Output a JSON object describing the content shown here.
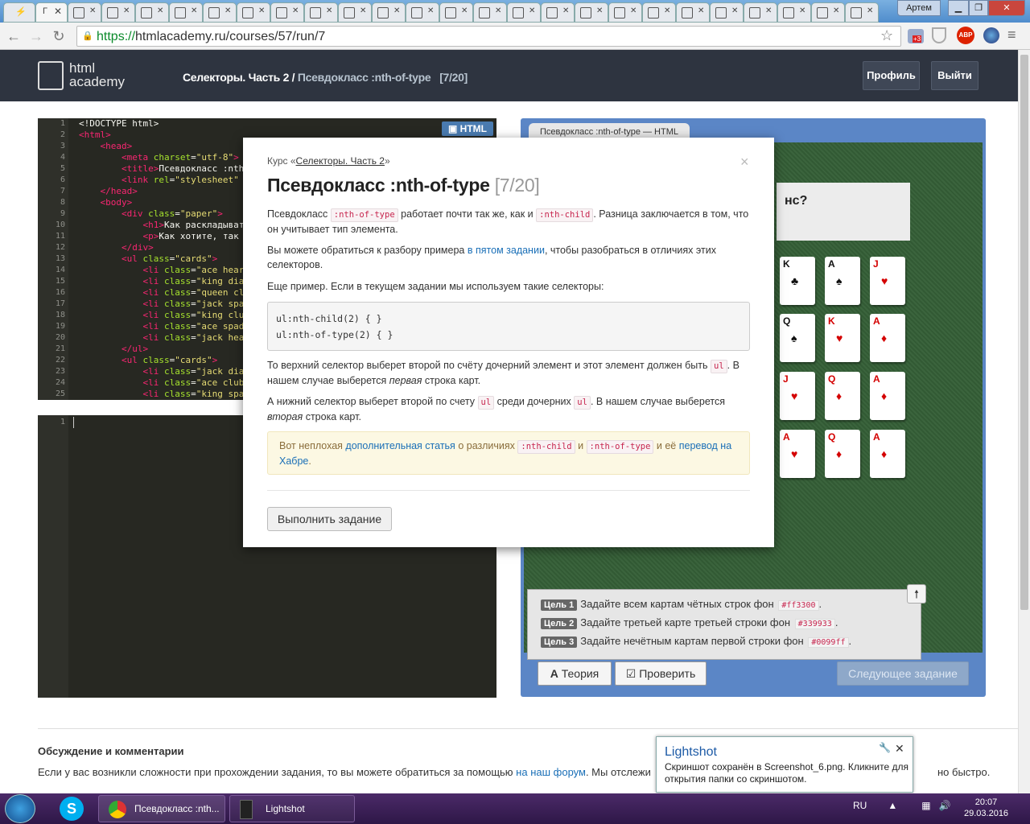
{
  "browser": {
    "url_scheme": "https://",
    "url_rest": "htmlacademy.ru/courses/57/run/7",
    "user_label": "Артем",
    "active_tab_label": "Г",
    "ext_badge": "+3",
    "abp_label": "ABP"
  },
  "site": {
    "logo_line1": "html",
    "logo_line2": "academy",
    "crumb_course": "Селекторы. Часть 2 /",
    "crumb_lesson": "Псевдокласс :nth-of-type",
    "crumb_count": "[7/20]",
    "profile_label": "Профиль",
    "logout_label": "Выйти"
  },
  "editor": {
    "tag_label": "HTML",
    "lines": [
      {
        "n": "1",
        "html": "<span class='w'>&lt;!DOCTYPE html&gt;</span>"
      },
      {
        "n": "2",
        "html": "<span class='t'>&lt;html&gt;</span>"
      },
      {
        "n": "3",
        "html": "    <span class='t'>&lt;head&gt;</span>"
      },
      {
        "n": "4",
        "html": "        <span class='t'>&lt;meta</span> <span class='a'>charset</span>=<span class='s'>\"utf-8\"</span><span class='t'>&gt;</span>"
      },
      {
        "n": "5",
        "html": "        <span class='t'>&lt;title&gt;</span><span class='w'>Псевдокласс :nth</span>"
      },
      {
        "n": "6",
        "html": "        <span class='t'>&lt;link</span> <span class='a'>rel</span>=<span class='s'>\"stylesheet\"</span>"
      },
      {
        "n": "7",
        "html": "    <span class='t'>&lt;/head&gt;</span>"
      },
      {
        "n": "8",
        "html": "    <span class='t'>&lt;body&gt;</span>"
      },
      {
        "n": "9",
        "html": "        <span class='t'>&lt;div</span> <span class='a'>class</span>=<span class='s'>\"paper\"</span><span class='t'>&gt;</span>"
      },
      {
        "n": "10",
        "html": "            <span class='t'>&lt;h1&gt;</span><span class='w'>Как раскладыват</span>"
      },
      {
        "n": "11",
        "html": "            <span class='t'>&lt;p&gt;</span><span class='w'>Как хотите, так</span>"
      },
      {
        "n": "12",
        "html": "        <span class='t'>&lt;/div&gt;</span>"
      },
      {
        "n": "13",
        "html": "        <span class='t'>&lt;ul</span> <span class='a'>class</span>=<span class='s'>\"cards\"</span><span class='t'>&gt;</span>"
      },
      {
        "n": "14",
        "html": "            <span class='t'>&lt;li</span> <span class='a'>class</span>=<span class='s'>\"ace hear</span>"
      },
      {
        "n": "15",
        "html": "            <span class='t'>&lt;li</span> <span class='a'>class</span>=<span class='s'>\"king dia</span>"
      },
      {
        "n": "16",
        "html": "            <span class='t'>&lt;li</span> <span class='a'>class</span>=<span class='s'>\"queen cl</span>"
      },
      {
        "n": "17",
        "html": "            <span class='t'>&lt;li</span> <span class='a'>class</span>=<span class='s'>\"jack spa</span>"
      },
      {
        "n": "18",
        "html": "            <span class='t'>&lt;li</span> <span class='a'>class</span>=<span class='s'>\"king clu</span>"
      },
      {
        "n": "19",
        "html": "            <span class='t'>&lt;li</span> <span class='a'>class</span>=<span class='s'>\"ace spad</span>"
      },
      {
        "n": "20",
        "html": "            <span class='t'>&lt;li</span> <span class='a'>class</span>=<span class='s'>\"jack hea</span>"
      },
      {
        "n": "21",
        "html": "        <span class='t'>&lt;/ul&gt;</span>"
      },
      {
        "n": "22",
        "html": "        <span class='t'>&lt;ul</span> <span class='a'>class</span>=<span class='s'>\"cards\"</span><span class='t'>&gt;</span>"
      },
      {
        "n": "23",
        "html": "            <span class='t'>&lt;li</span> <span class='a'>class</span>=<span class='s'>\"jack dia</span>"
      },
      {
        "n": "24",
        "html": "            <span class='t'>&lt;li</span> <span class='a'>class</span>=<span class='s'>\"ace club</span>"
      },
      {
        "n": "25",
        "html": "            <span class='t'>&lt;li</span> <span class='a'>class</span>=<span class='s'>\"king spa</span>"
      }
    ],
    "css_line_no": "1"
  },
  "preview": {
    "tab_label": "Псевдокласс :nth-of-type — HTML",
    "paper_heading": "нс?",
    "cards": [
      {
        "rank": "K",
        "suit": "♣",
        "color": "blk"
      },
      {
        "rank": "A",
        "suit": "♠",
        "color": "blk"
      },
      {
        "rank": "J",
        "suit": "♥",
        "color": "red"
      },
      {
        "rank": "Q",
        "suit": "♠",
        "color": "blk"
      },
      {
        "rank": "K",
        "suit": "♥",
        "color": "red"
      },
      {
        "rank": "A",
        "suit": "♦",
        "color": "red"
      },
      {
        "rank": "J",
        "suit": "♥",
        "color": "red"
      },
      {
        "rank": "Q",
        "suit": "♦",
        "color": "red"
      },
      {
        "rank": "A",
        "suit": "♦",
        "color": "red"
      },
      {
        "rank": "A",
        "suit": "♥",
        "color": "red"
      },
      {
        "rank": "Q",
        "suit": "♦",
        "color": "red"
      },
      {
        "rank": "A",
        "suit": "♦",
        "color": "red"
      }
    ],
    "goals": [
      {
        "label": "Цель 1",
        "text": "Задайте всем картам чётных строк фон",
        "code": "#ff3300",
        "end": "."
      },
      {
        "label": "Цель 2",
        "text": "Задайте третьей карте третьей строки фон",
        "code": "#339933",
        "end": "."
      },
      {
        "label": "Цель 3",
        "text": "Задайте нечётным картам первой строки фон",
        "code": "#0099ff",
        "end": "."
      }
    ],
    "theory_label": "Теория",
    "check_label": "Проверить",
    "next_label": "Следующее задание"
  },
  "modal": {
    "course_prefix": "Курс «",
    "course_link": "Селекторы. Часть 2",
    "course_suffix": "»",
    "close": "×",
    "title": "Псевдокласс :nth-of-type",
    "title_count": "[7/20]",
    "p1_a": "Псевдокласс",
    "p1_code1": ":nth-of-type",
    "p1_b": "работает почти так же, как и",
    "p1_code2": ":nth-child",
    "p1_c": ". Разница заключается в том, что он учитывает тип элемента.",
    "p2_a": "Вы можете обратиться к разбору примера",
    "p2_link": "в пятом задании",
    "p2_b": ", чтобы разобраться в отличиях этих селекторов.",
    "p3": "Еще пример. Если в текущем задании мы используем такие селекторы:",
    "pre1": "ul:nth-child(2) { }",
    "pre2": "ul:nth-of-type(2) { }",
    "p4_a": "То верхний селектор выберет второй по счёту дочерний элемент и этот элемент должен быть",
    "p4_code": "ul",
    "p4_b": ". В нашем случае выберется",
    "p4_em": "первая",
    "p4_c": "строка карт.",
    "p5_a": "А нижний селектор выберет второй по счету",
    "p5_code1": "ul",
    "p5_b": "среди дочерних",
    "p5_code2": "ul",
    "p5_c": ". В нашем случае выберется",
    "p5_em": "вторая",
    "p5_d": "строка карт.",
    "note_a": "Вот неплохая",
    "note_link1": "дополнительная статья",
    "note_b": "о различиях",
    "note_code1": ":nth-child",
    "note_c": "и",
    "note_code2": ":nth-of-type",
    "note_d": "и её",
    "note_link2": "перевод на Хабре",
    "note_e": ".",
    "run_label": "Выполнить задание"
  },
  "discussion": {
    "title": "Обсуждение и комментарии",
    "text_a": "Если у вас возникли сложности при прохождении задания, то вы можете обратиться за помощью",
    "text_link": "на наш форум",
    "text_b": ". Мы отслежи",
    "text_tail": "но быстро."
  },
  "lightshot": {
    "title": "Lightshot",
    "body": "Скриншот сохранён в Screenshot_6.png. Кликните для открытия папки со скриншотом."
  },
  "taskbar": {
    "chrome_label": "Псевдокласс :nth...",
    "lightshot_label": "Lightshot",
    "lang": "RU",
    "time": "20:07",
    "date": "29.03.2016"
  }
}
